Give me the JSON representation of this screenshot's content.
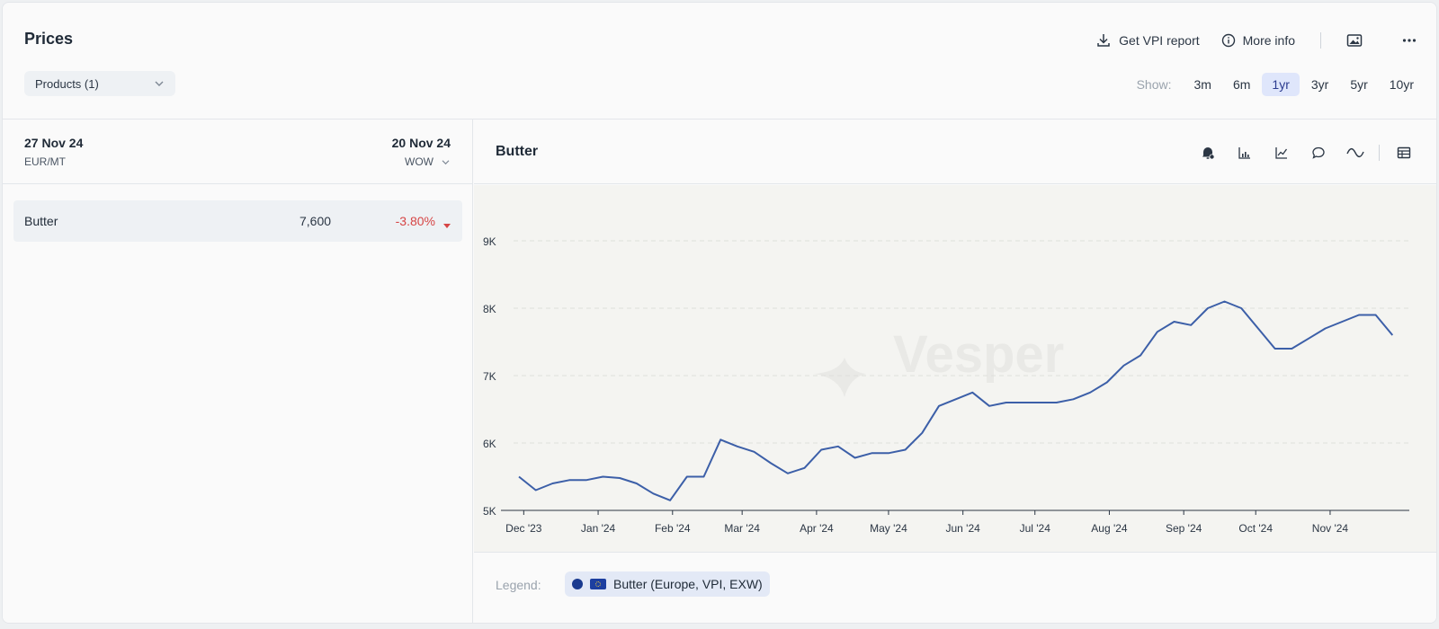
{
  "header": {
    "title": "Prices",
    "products_dropdown": "Products (1)",
    "actions": {
      "vpi_report": "Get VPI report",
      "more_info": "More info"
    },
    "range": {
      "label": "Show:",
      "options": [
        "3m",
        "6m",
        "1yr",
        "3yr",
        "5yr",
        "10yr"
      ],
      "active": "1yr"
    }
  },
  "left_panel": {
    "current_date": "27 Nov 24",
    "unit": "EUR/MT",
    "compare_date": "20 Nov 24",
    "compare_mode": "WOW",
    "rows": [
      {
        "name": "Butter",
        "value": "7,600",
        "change": "-3.80%"
      }
    ]
  },
  "chart_panel": {
    "title": "Butter",
    "legend_label": "Legend:",
    "legend_item": "Butter (Europe, VPI, EXW)",
    "watermark": "Vesper",
    "line_color": "#3c5fa8"
  },
  "chart_data": {
    "type": "line",
    "title": "Butter",
    "xlabel": "",
    "ylabel": "",
    "x_tick_labels": [
      "Dec '23",
      "Jan '24",
      "Feb '24",
      "Mar '24",
      "Apr '24",
      "May '24",
      "Jun '24",
      "Jul '24",
      "Aug '24",
      "Sep '24",
      "Oct '24",
      "Nov '24"
    ],
    "y_tick_labels": [
      "5K",
      "6K",
      "7K",
      "8K",
      "9K"
    ],
    "y_ticks": [
      5000,
      6000,
      7000,
      8000,
      9000
    ],
    "ylim": [
      5000,
      9000
    ],
    "x_range": [
      "2023-11-29",
      "2024-12-01"
    ],
    "grid": "horizontal dashed",
    "series": [
      {
        "name": "Butter (Europe, VPI, EXW)",
        "x": [
          "2023-11-29",
          "2023-12-06",
          "2023-12-13",
          "2023-12-20",
          "2023-12-27",
          "2024-01-03",
          "2024-01-10",
          "2024-01-17",
          "2024-01-24",
          "2024-01-31",
          "2024-02-07",
          "2024-02-14",
          "2024-02-21",
          "2024-02-28",
          "2024-03-06",
          "2024-03-13",
          "2024-03-20",
          "2024-03-27",
          "2024-04-03",
          "2024-04-10",
          "2024-04-17",
          "2024-04-24",
          "2024-05-01",
          "2024-05-08",
          "2024-05-15",
          "2024-05-22",
          "2024-05-29",
          "2024-06-05",
          "2024-06-12",
          "2024-06-19",
          "2024-06-26",
          "2024-07-03",
          "2024-07-10",
          "2024-07-17",
          "2024-07-24",
          "2024-07-31",
          "2024-08-07",
          "2024-08-14",
          "2024-08-21",
          "2024-08-28",
          "2024-09-04",
          "2024-09-11",
          "2024-09-18",
          "2024-09-25",
          "2024-10-02",
          "2024-10-09",
          "2024-10-16",
          "2024-10-23",
          "2024-10-30",
          "2024-11-06",
          "2024-11-13",
          "2024-11-20",
          "2024-11-27"
        ],
        "values": [
          5500,
          5300,
          5400,
          5450,
          5450,
          5500,
          5480,
          5400,
          5250,
          5150,
          5500,
          5500,
          6050,
          5950,
          5870,
          5700,
          5550,
          5630,
          5900,
          5950,
          5780,
          5850,
          5850,
          5900,
          6150,
          6550,
          6650,
          6750,
          6550,
          6600,
          6600,
          6600,
          6600,
          6650,
          6750,
          6900,
          7150,
          7300,
          7650,
          7800,
          7750,
          8000,
          8100,
          8000,
          7700,
          7400,
          7400,
          7550,
          7700,
          7800,
          7900,
          7900,
          7600
        ]
      }
    ]
  }
}
